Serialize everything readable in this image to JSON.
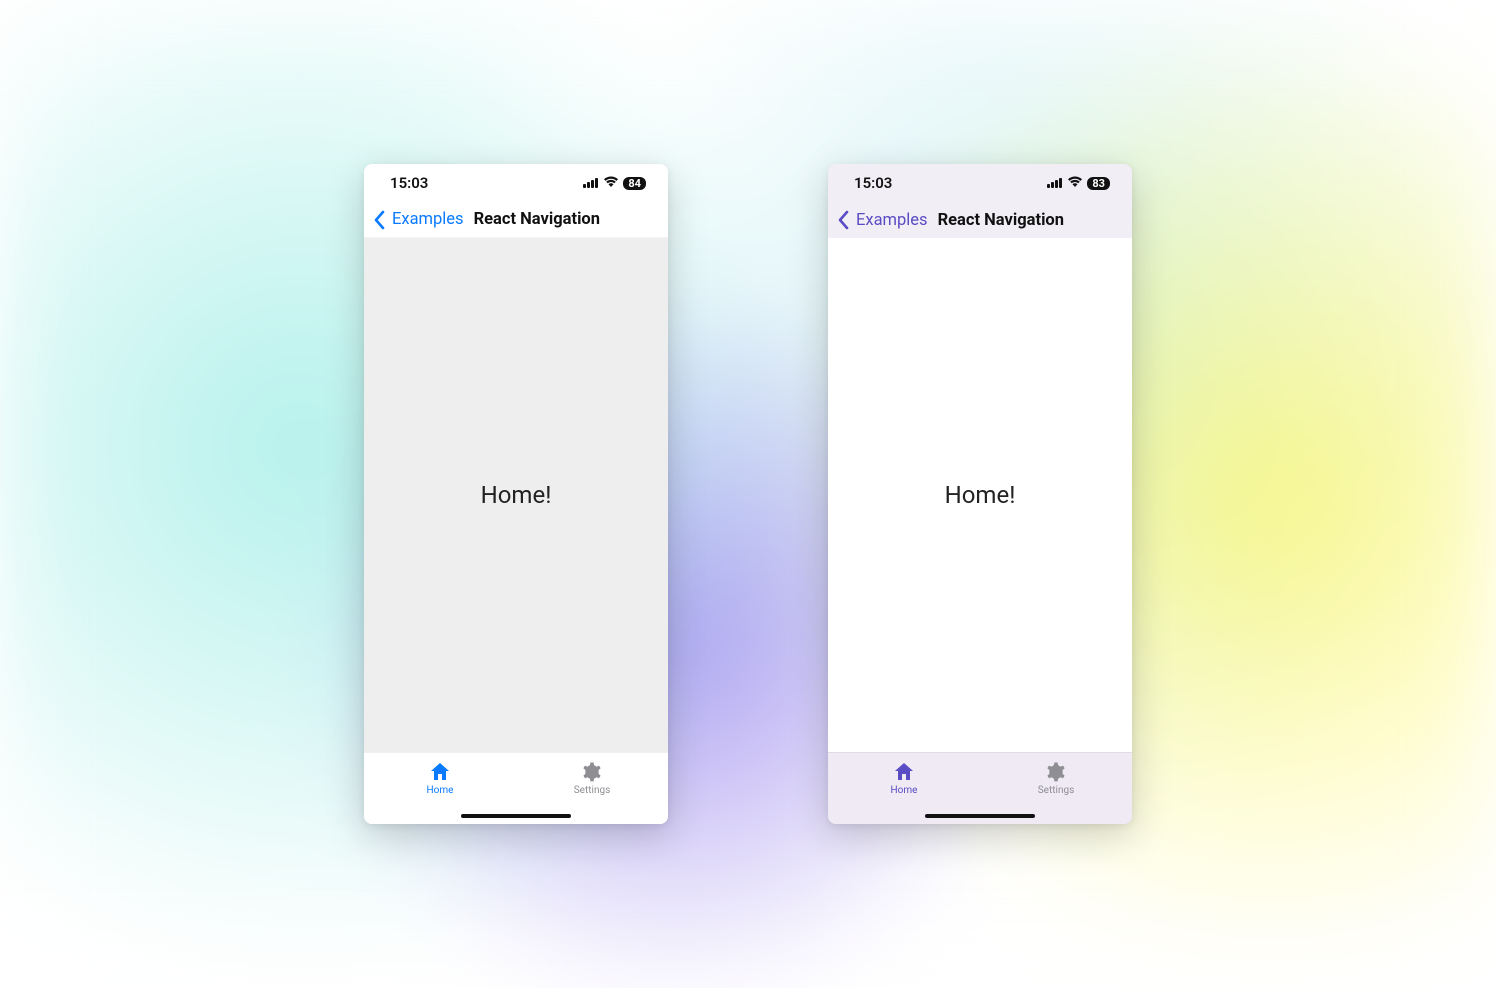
{
  "phones": [
    {
      "theme": "default",
      "status": {
        "time": "15:03",
        "battery": "84"
      },
      "nav": {
        "back_label": "Examples",
        "title": "React Navigation"
      },
      "content": {
        "text": "Home!"
      },
      "tabs": {
        "home_label": "Home",
        "settings_label": "Settings"
      }
    },
    {
      "theme": "purple",
      "status": {
        "time": "15:03",
        "battery": "83"
      },
      "nav": {
        "back_label": "Examples",
        "title": "React Navigation"
      },
      "content": {
        "text": "Home!"
      },
      "tabs": {
        "home_label": "Home",
        "settings_label": "Settings"
      }
    }
  ]
}
